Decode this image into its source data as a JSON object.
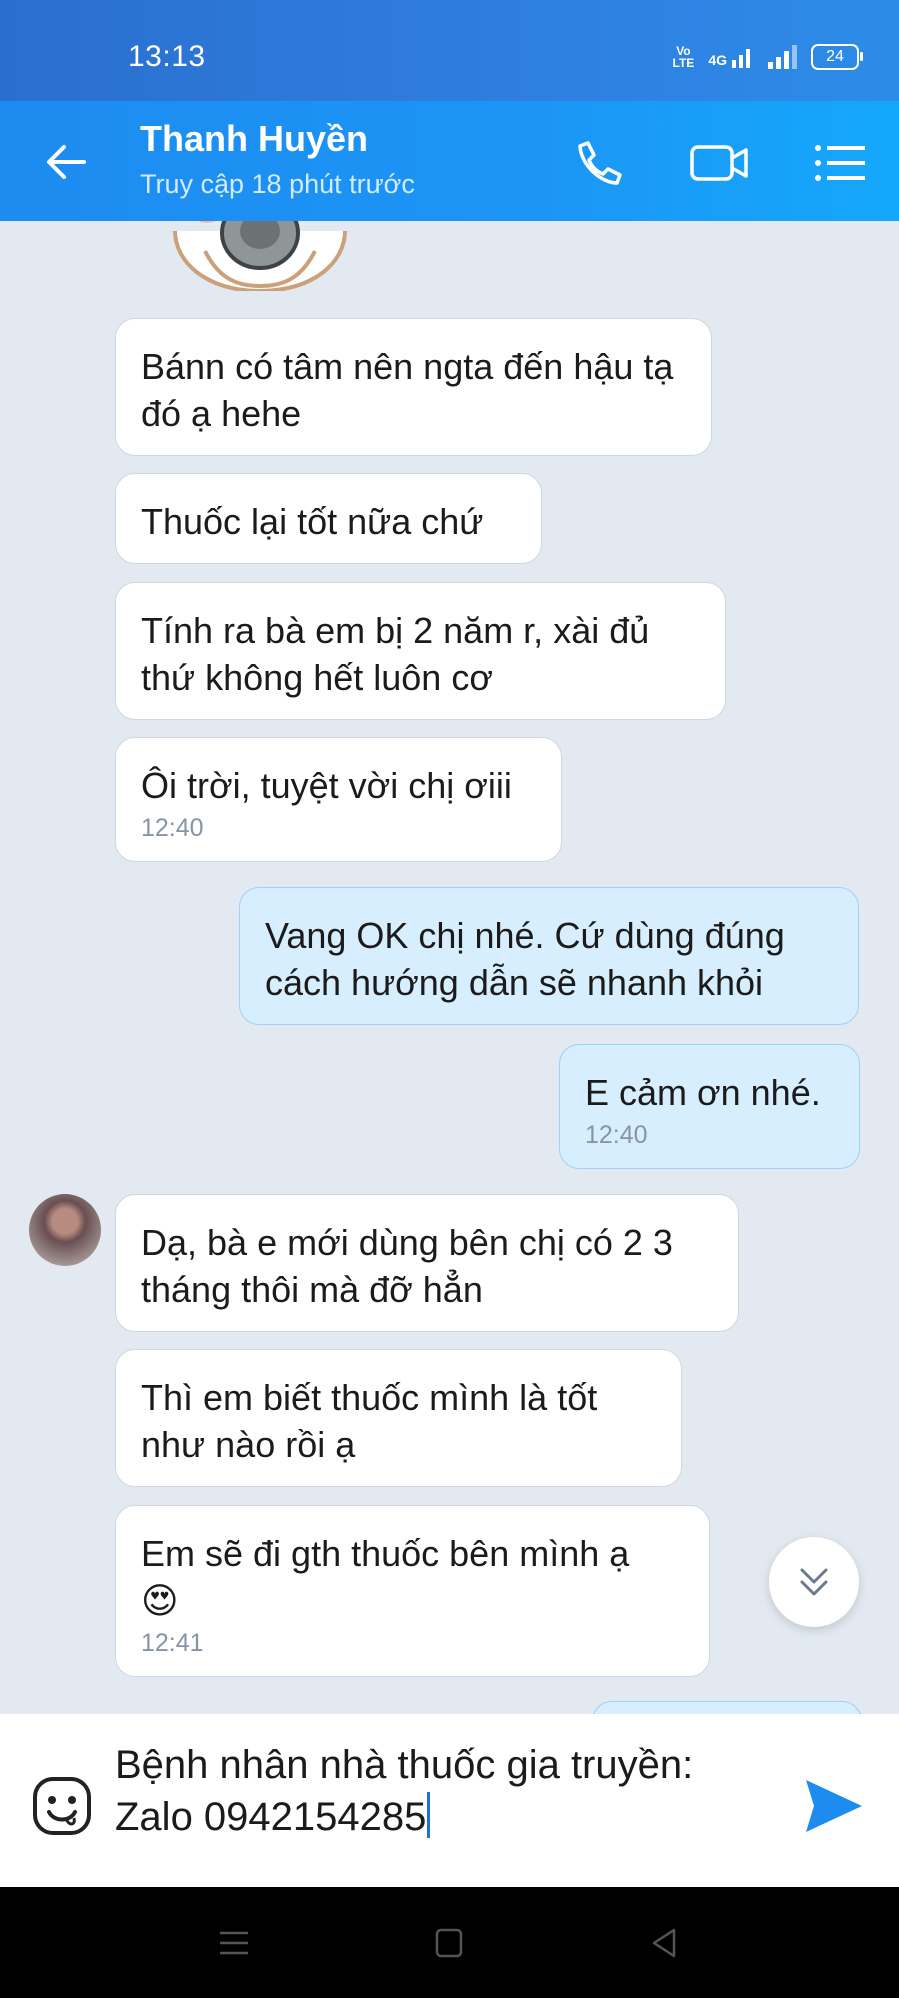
{
  "status_bar": {
    "time": "13:13",
    "volte_top": "Vo",
    "volte_bottom": "LTE",
    "network": "4G",
    "battery": "24"
  },
  "header": {
    "name": "Thanh Huyền",
    "status": "Truy cập 18 phút trước"
  },
  "messages": [
    {
      "text": "Bánn có tâm nên ngta đến hậu tạ đó ạ hehe"
    },
    {
      "text": "Thuốc lại tốt nữa chứ"
    },
    {
      "text": "Tính ra bà em bị 2 năm r, xài đủ thứ không hết luôn cơ"
    },
    {
      "text": "Ôi trời, tuyệt vời chị ơiii",
      "time": "12:40"
    },
    {
      "text": "Vang OK chị nhé. Cứ dùng đúng cách hướng dẫn sẽ nhanh khỏi"
    },
    {
      "text": "E cảm ơn nhé.",
      "time": "12:40"
    },
    {
      "text": "Dạ, bà e mới dùng bên chị có 2 3 tháng thôi mà đỡ hẳn"
    },
    {
      "text": "Thì em biết thuốc mình là tốt như nào rồi ạ"
    },
    {
      "text": "Em sẽ đi gth thuốc bên mình ạ",
      "emoji": "😍",
      "time": "12:41"
    }
  ],
  "composer": {
    "line1": "Bệnh nhân nhà thuốc gia truyền:",
    "line2": "Zalo 0942154285"
  },
  "colors": {
    "header": "#1d8bf0",
    "outgoing_bubble": "#d6eefe",
    "chat_bg": "#e2e9f1",
    "send": "#1d8bf0"
  },
  "icons": [
    "back-arrow-icon",
    "phone-icon",
    "video-call-icon",
    "menu-list-icon",
    "chevron-double-down-icon",
    "emoji-icon",
    "send-icon"
  ]
}
